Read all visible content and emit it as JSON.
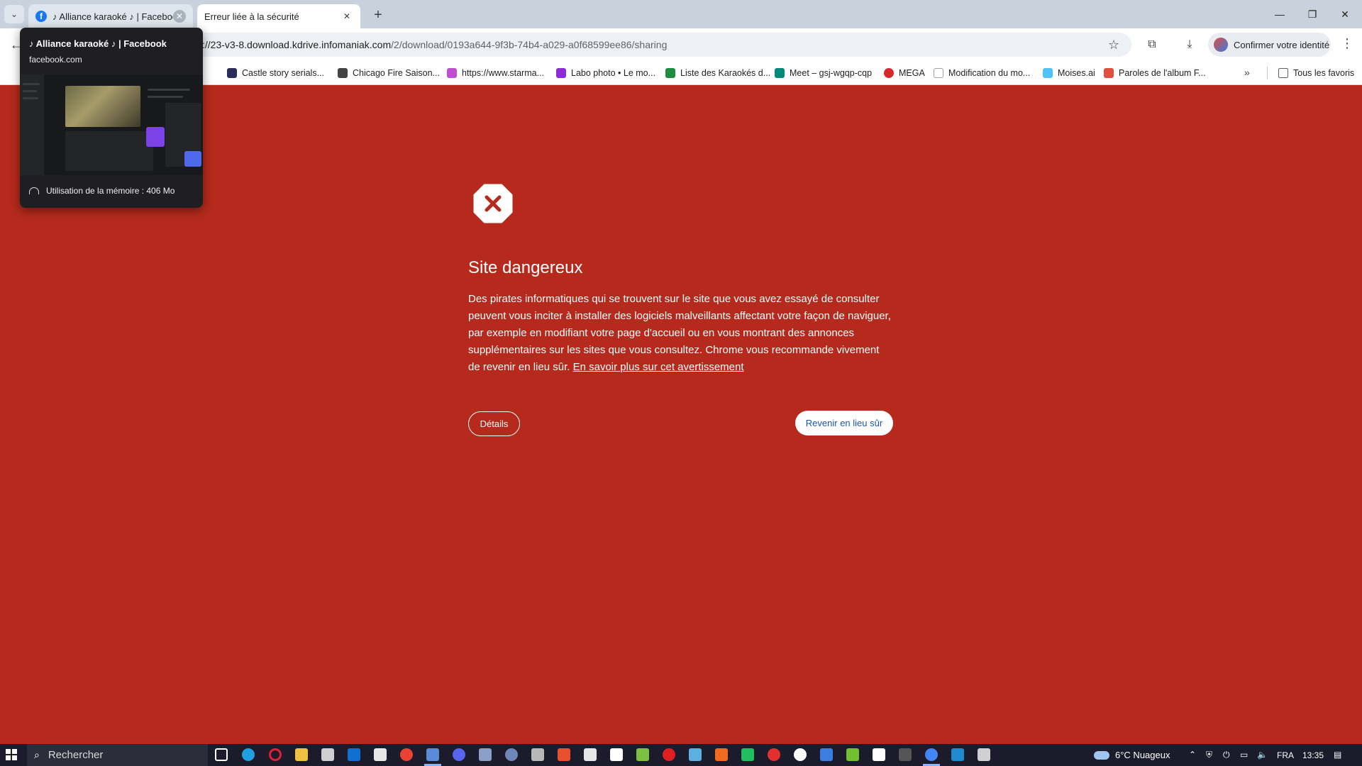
{
  "tabs": [
    {
      "title": "♪ Alliance karaoké ♪ | Facebook",
      "favicon": "facebook-icon"
    },
    {
      "title": "Erreur liée à la sécurité"
    }
  ],
  "address": {
    "prefix": "https://",
    "host": "23-v3-8.download.kdrive.infomaniak.com",
    "path": "/2/download/0193a644-9f3b-74b4-a029-a0f68599ee86/sharing",
    "visible_start": "s://23-v3-8.download.kdrive.infomaniak.com"
  },
  "toolbar": {
    "identity_label": "Confirmer votre identité"
  },
  "bookmarks": [
    {
      "label": "Castle story serials...",
      "color": "#2c2c5a"
    },
    {
      "label": "Chicago Fire Saison...",
      "color": "#444444"
    },
    {
      "label": "https://www.starma...",
      "color": "#c04fd0"
    },
    {
      "label": "Labo photo • Le mo...",
      "color": "#8e2bd8"
    },
    {
      "label": "Liste des Karaokés d...",
      "color": "#1e8e3e"
    },
    {
      "label": "Meet – gsj-wgqp-cqp",
      "color": "#00897b"
    },
    {
      "label": "MEGA",
      "color": "#d9272e"
    },
    {
      "label": "Modification du mo...",
      "color": "#9aa0a6"
    },
    {
      "label": "Moises.ai",
      "color": "#4fc3f7"
    },
    {
      "label": "Paroles de l'album F...",
      "color": "#e0503c"
    }
  ],
  "bookmarks_all_label": "Tous les favoris",
  "hovercard": {
    "title": "♪ Alliance karaoké ♪ | Facebook",
    "domain": "facebook.com",
    "memory": "Utilisation de la mémoire : 406 Mo"
  },
  "interstitial": {
    "title": "Site dangereux",
    "body": "Des pirates informatiques qui se trouvent sur le site que vous avez essayé de consulter peuvent vous inciter à installer des logiciels malveillants affectant votre façon de naviguer, par exemple en modifiant votre page d'accueil ou en vous montrant des annonces supplémentaires sur les sites que vous consultez. Chrome vous recommande vivement de revenir en lieu sûr. ",
    "link": "En savoir plus sur cet avertissement",
    "details_button": "Détails",
    "back_button": "Revenir en lieu sûr",
    "background_color": "#b52a1c"
  },
  "taskbar": {
    "search_placeholder": "Rechercher",
    "weather": "6°C  Nuageux",
    "language": "FRA",
    "time": "13:35"
  }
}
